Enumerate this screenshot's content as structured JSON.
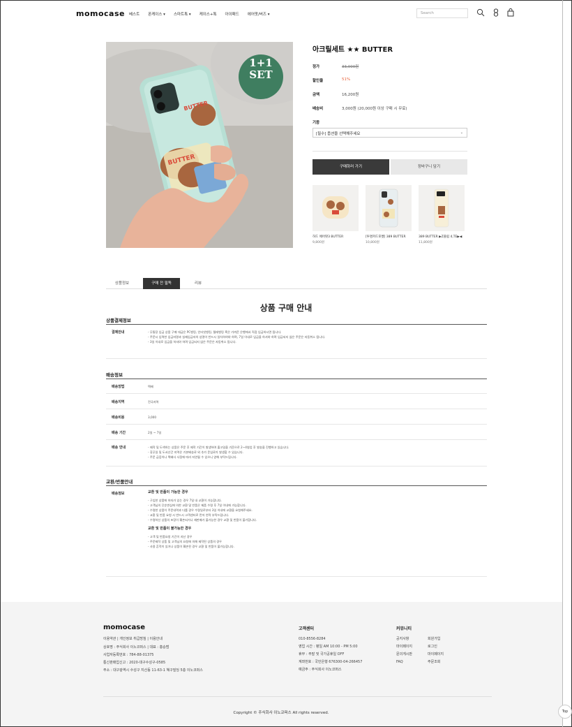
{
  "header": {
    "logo": "momocase",
    "nav": [
      "베스트",
      "폰케이스 ▾",
      "스마트톡 ▾",
      "케이스+톡",
      "아이패드",
      "에어팟/버즈 ▾"
    ],
    "search_placeholder": "Search",
    "icons": [
      "search-icon",
      "user-icon",
      "bag-icon"
    ]
  },
  "product": {
    "badge_line1": "1+1",
    "badge_line2": "SET",
    "title": "아크릴세트 ★★ BUTTER",
    "specs": [
      {
        "label": "정가",
        "value": "33,000원"
      },
      {
        "label": "할인율",
        "value": "51%"
      },
      {
        "label": "금액",
        "value": "16,200원"
      },
      {
        "label": "배송비",
        "value": "3,000원 (20,000원 이상 구매 시 무료)"
      }
    ],
    "option_label": "기종",
    "option_selected": "[필수] 옵션을 선택해주세요",
    "buy_label": "구매하러 가기",
    "cart_label": "장바구니 담기",
    "related": [
      {
        "name": "하드 에어팟3 BUTTER",
        "price": "9,800원"
      },
      {
        "name": "[투명카드포켓] 389 BUTTER",
        "price": "10,800원"
      },
      {
        "name": "389 BUTTER ▶Z플립 4,TE▶◀",
        "price": "11,800원"
      }
    ]
  },
  "tabs": [
    "상품정보",
    "구매 전 필독",
    "리뷰"
  ],
  "guide": {
    "title": "상품 구매 안내",
    "payment": {
      "heading": "상품결제정보",
      "label": "결제안내",
      "lines": [
        "- 무통장 입금 상품 구매 대금은 PC뱅킹, 인터넷뱅킹, 텔레뱅킹 혹은 가까운 은행에서 직접 입금하시면 됩니다.",
        "- 주문시 입력한 입금자명과 실제입금자의 성명이 반드시 일치하여야 하며, 7일 이내로 입금을 하셔야 하며 입금되지 않은 주문은 자동취소 됩니다.",
        "- 3일 이내로 입금을 하셔야 하며 입금되지 않은 주문은 자동취소 됩니다."
      ]
    },
    "delivery": {
      "heading": "배송정보",
      "rows": [
        {
          "label": "배송방법",
          "value": "택배"
        },
        {
          "label": "배송지역",
          "value": "전국지역"
        },
        {
          "label": "배송비용",
          "value": "3,000"
        },
        {
          "label": "배송 기간",
          "value": "2일 ~ 7일"
        }
      ],
      "notice_label": "배송 안내",
      "notice_lines": [
        "- 제작 및 도색하는 상품은 주문 후 제작 기간이 발생하여 출고일을 기준으로 2~4영업 후 발송을 진행하고 있습니다.",
        "- 휴무일 및 도서산간 지역은 기본배송료 외 추가 운임료가 발생할 수 있습니다.",
        "- 주문 급증이나 택배사 사정에 따라 지연될 수 있으니 양해 부탁드립니다."
      ]
    },
    "exchange": {
      "heading": "교환/반품안내",
      "label": "배송정보",
      "possible_heading": "교환 및 반품이 가능한 경우",
      "possible_lines": [
        "- 구입한 상품에 하자가 있는 경우 7일 내 교환이 가능합니다.",
        "- 고객님의 단순변심에 의한 교환 및 반품은 제품 수령 후 7일 이내에 가능합니다.",
        "- 수령한 상품이 주문내역과 다를 경우 수령일로부터 3일 이내에 교환을 요청해주세요.",
        "- 교환 및 반품 요청 시 반드시 고객센터로 먼저 연락 부탁드립니다.",
        "- 수령하신 상품의 포장이 훼손되거나 재판매가 불가능한 경우 교환 및 반품이 불가합니다."
      ],
      "impossible_heading": "교환 및 반품이 불가능한 경우",
      "impossible_lines": [
        "- 고객 및 반품요청 기간이 지난 경우",
        "- 주문제작 상품 및 고객님의 요청에 의해 제작된 상품의 경우",
        "- 사용 흔적이 있거나 상품이 훼손된 경우 교환 및 반품이 불가능합니다."
      ]
    }
  },
  "footer": {
    "logo": "momocase",
    "links": "이용약관  |  개인정보 취급방침  |  이용안내",
    "company_lines": [
      "상호명 : 주식회사 이노코퍼스 | 대표 : 홍승범",
      "사업자등록번호 : 784-88-01375",
      "통신판매업신고 : 2020-대구수성구-0585",
      "주소 : 대구광역시 수성구 지산동 11-63-1 혜구빌딩 5층 이노코퍼스"
    ],
    "cs_heading": "고객센터",
    "cs_lines": [
      "010-8556-8284",
      "영업 시간 : 평일 AM 10:00 - PM 5:00",
      "휴무 : 주말 및 국가공휴일 OFF",
      "계좌번호 : 국민은행 676300-04-266457",
      "예금주 : 주식회사 이노코퍼스"
    ],
    "community_heading": "커뮤니티",
    "community_col1": [
      "공지사항",
      "마이페이지",
      "문의게시판",
      "FAQ"
    ],
    "community_col2": [
      "회원가입",
      "로그인",
      "마이페이지",
      "주문조회"
    ],
    "copyright": "Copyright © 주식회사 이노코퍼스 All rights reserved.",
    "top_label": "Top"
  }
}
